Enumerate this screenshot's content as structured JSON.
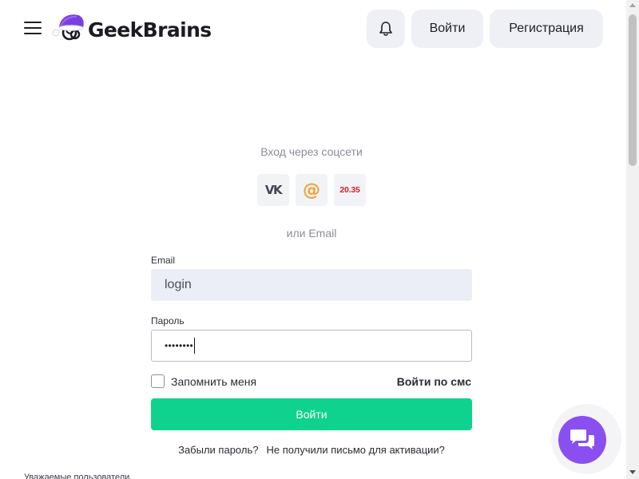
{
  "header": {
    "brand": "GeekBrains",
    "login_label": "Войти",
    "register_label": "Регистрация"
  },
  "social": {
    "title": "Вход через соцсети",
    "providers": [
      {
        "name": "vk",
        "label": "VK"
      },
      {
        "name": "mailru",
        "label": "@"
      },
      {
        "name": "2035",
        "label": "20.35"
      }
    ],
    "or_email": "или Email"
  },
  "form": {
    "email_label": "Email",
    "email_value": "login",
    "password_label": "Пароль",
    "password_value": "••••••••",
    "remember_label": "Запомнить меня",
    "sms_label": "Войти по смс",
    "submit_label": "Войти"
  },
  "links": {
    "forgot_password": "Забыли пароль?",
    "no_activation": "Не получили письмо для активации?"
  },
  "notice": "Уважаемые пользователи",
  "colors": {
    "accent_green": "#0fd28f",
    "chat_purple": "#8a4ff0",
    "button_bg": "#eef0f6",
    "input_bg": "#eceef7"
  },
  "icons": {
    "menu": "burger-menu-icon",
    "logo": "santa-hat-brain-logo",
    "bell": "bell-icon",
    "chat": "chat-bubbles-icon"
  }
}
